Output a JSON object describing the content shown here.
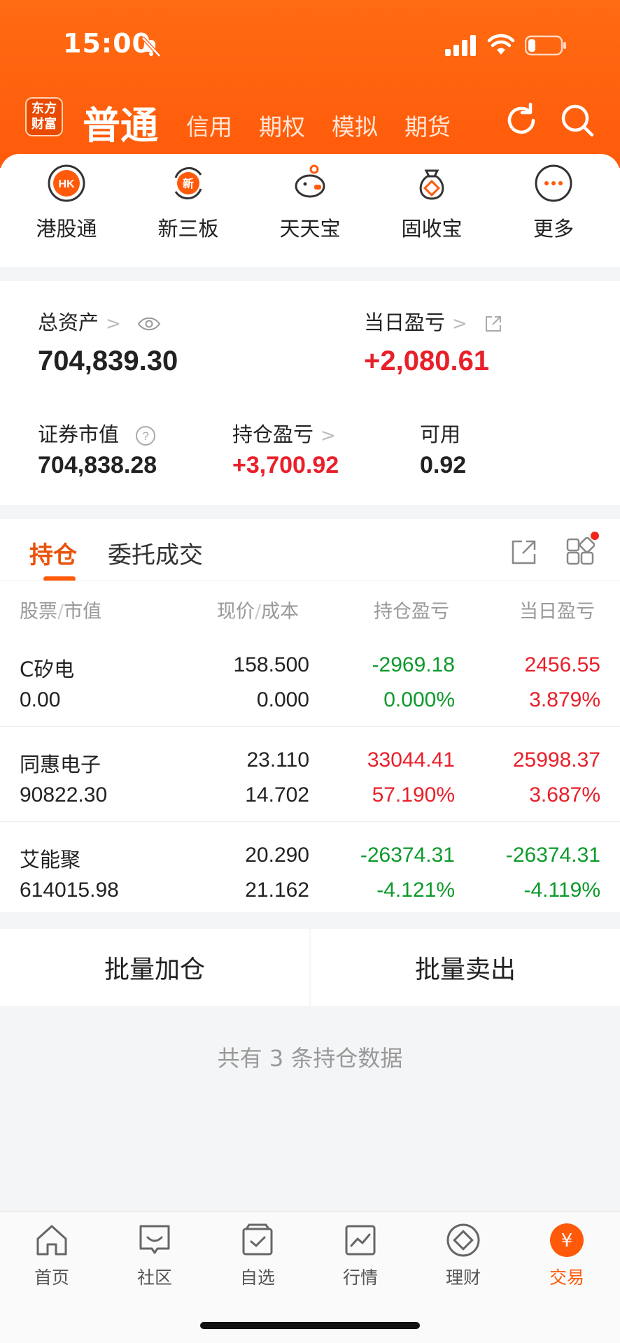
{
  "status": {
    "time": "15:00"
  },
  "header": {
    "logo_line1": "东方",
    "logo_line2": "财富",
    "tab_main": "普通",
    "tabs": [
      "信用",
      "期权",
      "模拟",
      "期货"
    ]
  },
  "quick": [
    {
      "label": "港股通",
      "icon": "hk-icon"
    },
    {
      "label": "新三板",
      "icon": "new-board-icon"
    },
    {
      "label": "天天宝",
      "icon": "piggy-bank-icon"
    },
    {
      "label": "固收宝",
      "icon": "money-bag-icon"
    },
    {
      "label": "更多",
      "icon": "more-icon"
    }
  ],
  "assets": {
    "total_label": "总资产",
    "total_value": "704,839.30",
    "daily_label": "当日盈亏",
    "daily_value": "+2,080.61",
    "market_label": "证券市值",
    "market_value": "704,838.28",
    "position_label": "持仓盈亏",
    "position_value": "+3,700.92",
    "available_label": "可用",
    "available_value": "0.92"
  },
  "positions": {
    "tab_active": "持仓",
    "tab_other": "委托成交",
    "columns": {
      "stock": "股票",
      "market": "市值",
      "price": "现价",
      "cost": "成本",
      "pnl": "持仓盈亏",
      "daily": "当日盈亏"
    },
    "rows": [
      {
        "name": "C矽电",
        "value": "0.00",
        "price": "158.500",
        "cost": "0.000",
        "pnl": "-2969.18",
        "pnl_pct": "0.000%",
        "daily": "2456.55",
        "daily_pct": "3.879%"
      },
      {
        "name": "同惠电子",
        "value": "90822.30",
        "price": "23.110",
        "cost": "14.702",
        "pnl": "33044.41",
        "pnl_pct": "57.190%",
        "daily": "25998.37",
        "daily_pct": "3.687%"
      },
      {
        "name": "艾能聚",
        "value": "614015.98",
        "price": "20.290",
        "cost": "21.162",
        "pnl": "-26374.31",
        "pnl_pct": "-4.121%",
        "daily": "-26374.31",
        "daily_pct": "-4.119%"
      }
    ]
  },
  "batch": {
    "add": "批量加仓",
    "sell": "批量卖出"
  },
  "summary": "共有 3 条持仓数据",
  "bottom_nav": [
    {
      "label": "首页",
      "icon": "home-icon"
    },
    {
      "label": "社区",
      "icon": "community-icon"
    },
    {
      "label": "自选",
      "icon": "watchlist-icon"
    },
    {
      "label": "行情",
      "icon": "market-icon"
    },
    {
      "label": "理财",
      "icon": "finance-icon"
    },
    {
      "label": "交易",
      "icon": "trade-icon"
    }
  ],
  "colors": {
    "brand": "#ff5a0a",
    "up": "#e8202a",
    "down": "#0c9a2a"
  }
}
